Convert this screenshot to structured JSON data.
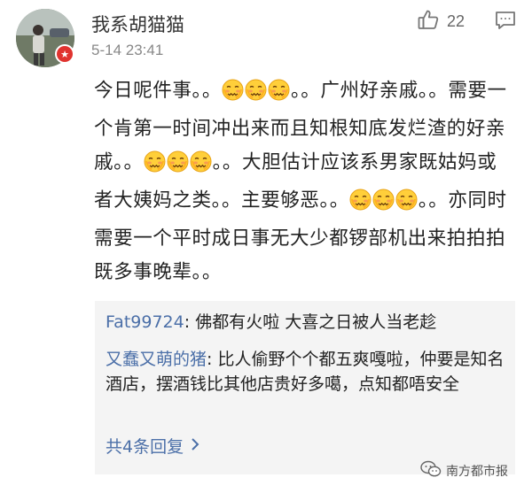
{
  "comment": {
    "username": "我系胡猫猫",
    "timestamp": "5-14 23:41",
    "like_count": "22",
    "icons": {
      "like": "thumbs-up-icon",
      "reply": "reply-icon",
      "emoji": "embarrassed-face-emoji"
    },
    "body": [
      {
        "type": "text",
        "value": "今日呢件事。。"
      },
      {
        "type": "emoji",
        "count": 3
      },
      {
        "type": "text",
        "value": "。。广州好亲戚。。需要一个肯第一时间冲出来而且知根知底发烂渣的好亲戚。。"
      },
      {
        "type": "emoji",
        "count": 3
      },
      {
        "type": "text",
        "value": "。。大胆估计应该系男家既姑妈或者大姨妈之类。。主要够恶。。"
      },
      {
        "type": "emoji",
        "count": 3
      },
      {
        "type": "text",
        "value": "。。亦同时需要一个平时成日事无大少都锣部机出来拍拍拍既多事晚辈。。"
      }
    ]
  },
  "replies": {
    "items": [
      {
        "author": "Fat99724",
        "text": "佛都有火啦 大喜之日被人当老趁"
      },
      {
        "author": "又蠢又萌的猪",
        "text": "比人偷野个个都五爽嘎啦，仲要是知名酒店，摆酒钱比其他店贵好多噶，点知都唔安全"
      }
    ],
    "more_label": "共4条回复",
    "more_icon": "chevron-right-icon"
  },
  "watermark": {
    "text": "南方都市报",
    "icon": "wechat-icon"
  },
  "colors": {
    "link": "#4b6fa8",
    "reply_background": "#f4f4f4",
    "badge": "#e0332f"
  }
}
